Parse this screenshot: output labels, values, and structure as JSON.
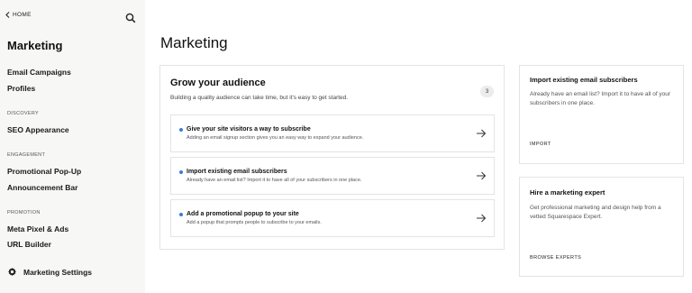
{
  "sidebar": {
    "home_label": "HOME",
    "title": "Marketing",
    "items": [
      {
        "label": "Email Campaigns"
      },
      {
        "label": "Profiles"
      }
    ],
    "sections": [
      {
        "heading": "DISCOVERY",
        "items": [
          {
            "label": "SEO Appearance"
          }
        ]
      },
      {
        "heading": "ENGAGEMENT",
        "items": [
          {
            "label": "Promotional Pop-Up"
          },
          {
            "label": "Announcement Bar"
          }
        ]
      },
      {
        "heading": "PROMOTION",
        "items": [
          {
            "label": "Meta Pixel & Ads"
          },
          {
            "label": "URL Builder"
          }
        ]
      }
    ],
    "settings_label": "Marketing Settings"
  },
  "main": {
    "title": "Marketing",
    "grow": {
      "title": "Grow your audience",
      "subtitle": "Building a quality audience can take time, but it's easy to get started.",
      "badge": "3",
      "tasks": [
        {
          "title": "Give your site visitors a way to subscribe",
          "desc": "Adding an email signup section gives you an easy way to expand your audience."
        },
        {
          "title": "Import existing email subscribers",
          "desc": "Already have an email list? Import it to have all of your subscribers in one place."
        },
        {
          "title": "Add a promotional popup to your site",
          "desc": "Add a popup that prompts people to subscribe to your emails."
        }
      ]
    },
    "cards": [
      {
        "title": "Import existing email subscribers",
        "body": "Already have an email list? Import it to have all of your subscribers in one place.",
        "link": "IMPORT"
      },
      {
        "title": "Hire a marketing expert",
        "body": "Get professional marketing and design help from a vetted Squarespace Expert.",
        "link": "BROWSE EXPERTS"
      }
    ]
  },
  "colors": {
    "accent_dot": "#3c7bd9",
    "sidebar_bg": "#f7f7f5",
    "border": "#e4e4e4"
  }
}
